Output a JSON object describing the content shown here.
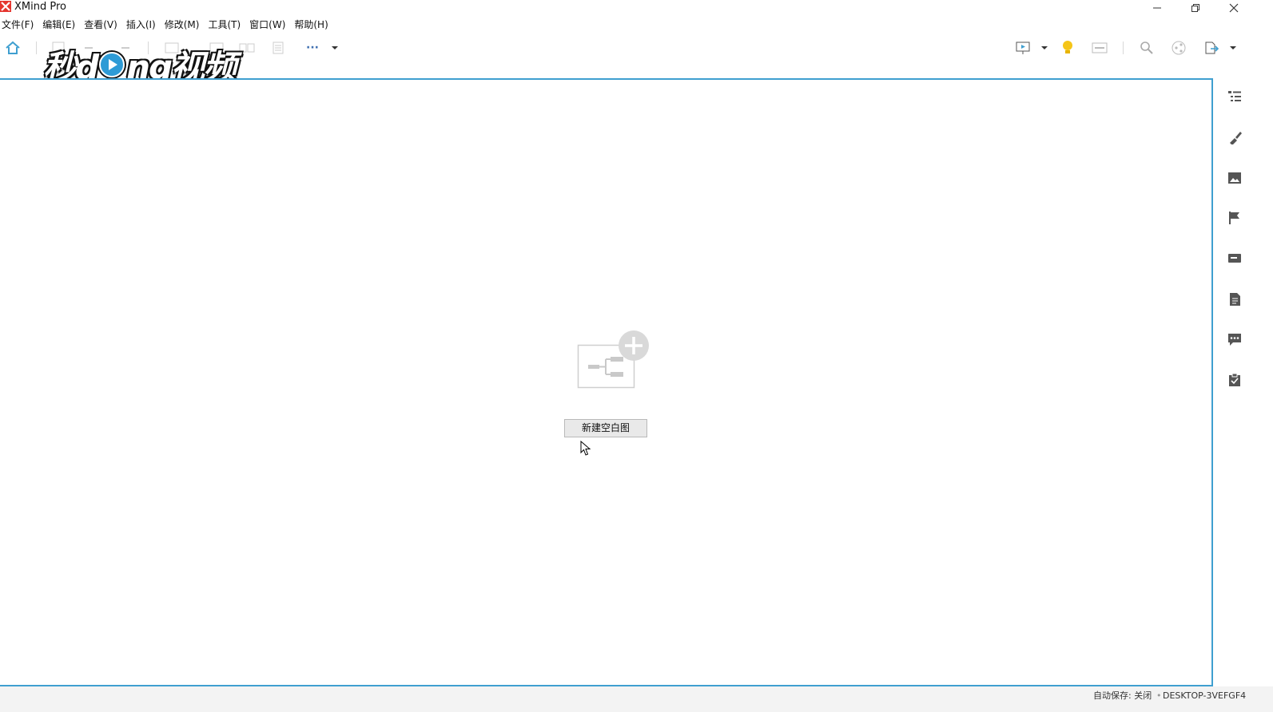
{
  "window": {
    "title": "XMind Pro",
    "controls": {
      "minimize": "minimize-icon",
      "restore": "restore-icon",
      "close": "close-icon"
    }
  },
  "menu": {
    "items": [
      {
        "label": "文件(F)"
      },
      {
        "label": "编辑(E)"
      },
      {
        "label": "查看(V)"
      },
      {
        "label": "插入(I)"
      },
      {
        "label": "修改(M)"
      },
      {
        "label": "工具(T)"
      },
      {
        "label": "窗口(W)"
      },
      {
        "label": "帮助(H)"
      }
    ]
  },
  "toolbar": {
    "more_label": "···",
    "left_icons": [
      "home-icon",
      "save-icon",
      "undo-icon",
      "redo-icon",
      "topic-icon",
      "subtopic-icon",
      "relationship-icon",
      "boundary-icon",
      "more-icon",
      "dropdown-icon"
    ],
    "right_icons": [
      "presentation-icon",
      "dropdown-icon",
      "idea-bulb-icon",
      "layout-icon",
      "search-icon",
      "share-icon",
      "export-icon",
      "dropdown-icon"
    ]
  },
  "watermark": {
    "text_before": "秒d",
    "text_after": "ng视频"
  },
  "canvas": {
    "new_blank_button": "新建空白图",
    "illustration": "new-mindmap-icon"
  },
  "side_panel": {
    "icons": [
      "outline-icon",
      "format-brush-icon",
      "image-icon",
      "marker-flag-icon",
      "label-icon",
      "notes-icon",
      "comment-icon",
      "task-icon"
    ]
  },
  "status": {
    "autosave": "自动保存: 关闭",
    "computer": "DESKTOP-3VEFGF4"
  },
  "colors": {
    "accent": "#3f9fd0",
    "logo": "#e5352e",
    "bulb": "#f5c518"
  }
}
